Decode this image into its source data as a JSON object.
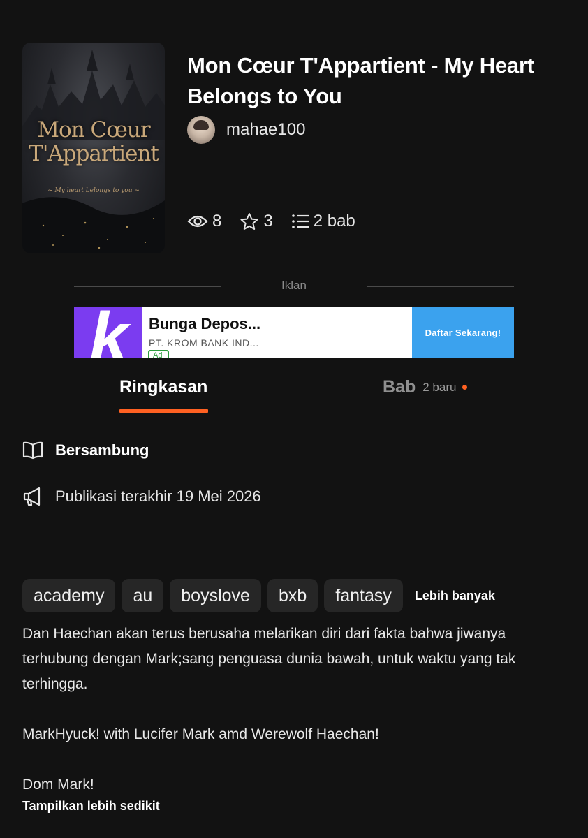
{
  "cover": {
    "title_line1": "Mon Cœur",
    "title_line2": "T'Appartient",
    "subtitle": "~ My heart belongs to you ~"
  },
  "story": {
    "title": "Mon Cœur T'Appartient - My Heart Belongs to You",
    "author": "mahae100"
  },
  "stats": {
    "reads": "8",
    "votes": "3",
    "chapters": "2 bab"
  },
  "ad": {
    "label": "Iklan",
    "logo_letter": "k",
    "title": "Bunga Depos...",
    "advertiser": "PT. KROM BANK IND...",
    "badge": "Ad",
    "cta": "Daftar Sekarang!",
    "brand_color": "#7b3cf0",
    "cta_color": "#3ba2ee"
  },
  "tabs": {
    "summary": "Ringkasan",
    "chapters": "Bab",
    "new_count": "2 baru",
    "accent_color": "#ff6122"
  },
  "details": {
    "status": "Bersambung",
    "last_published": "Publikasi terakhir 19 Mei 2026"
  },
  "tags": [
    "academy",
    "au",
    "boyslove",
    "bxb",
    "fantasy"
  ],
  "more_tags": "Lebih banyak",
  "description": {
    "paragraph1": "Dan Haechan akan terus berusaha melarikan diri dari fakta bahwa jiwanya terhubung dengan Mark;sang penguasa dunia bawah, untuk waktu yang tak terhingga.",
    "paragraph2": "MarkHyuck! with Lucifer Mark amd Werewolf Haechan!",
    "paragraph3": "Dom Mark!"
  },
  "show_less": "Tampilkan lebih sedikit"
}
